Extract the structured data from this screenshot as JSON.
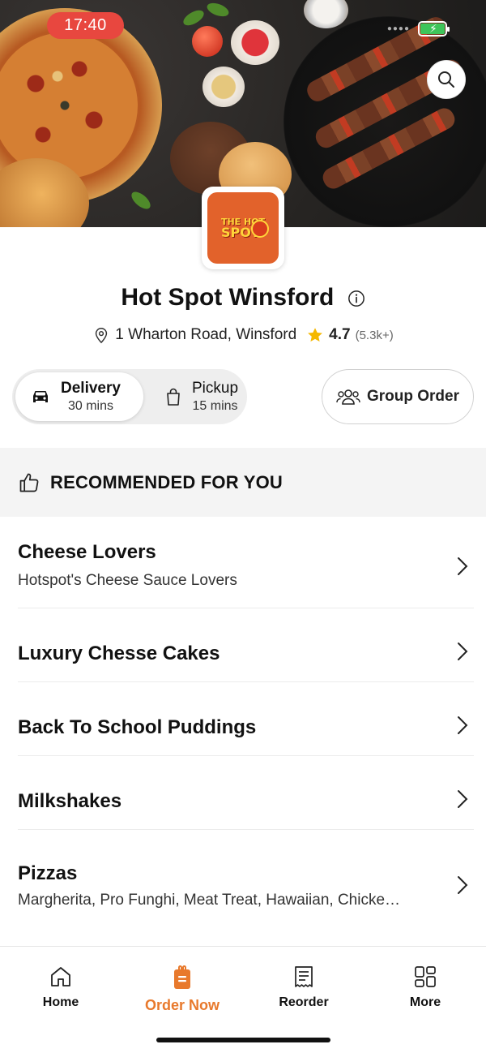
{
  "status_bar": {
    "time": "17:40"
  },
  "store": {
    "name": "Hot Spot Winsford",
    "logo_text_line1": "THE HOT",
    "logo_text_line2": "SPOT",
    "address": "1 Wharton Road, Winsford",
    "rating": "4.7",
    "reviews": "(5.3k+)"
  },
  "order_mode": {
    "delivery": {
      "label": "Delivery",
      "time": "30 mins"
    },
    "pickup": {
      "label": "Pickup",
      "time": "15 mins"
    },
    "selected": "delivery"
  },
  "group_order": {
    "label": "Group Order"
  },
  "section": {
    "title": "RECOMMENDED FOR YOU"
  },
  "menu": [
    {
      "title": "Cheese Lovers",
      "subtitle": "Hotspot's Cheese Sauce Lovers"
    },
    {
      "title": "Luxury Chesse Cakes",
      "subtitle": ""
    },
    {
      "title": "Back To School Puddings",
      "subtitle": ""
    },
    {
      "title": "Milkshakes",
      "subtitle": ""
    },
    {
      "title": "Pizzas",
      "subtitle": "Margherita, Pro Funghi, Meat Treat, Hawaiian, Chicke…"
    }
  ],
  "tabs": [
    {
      "label": "Home",
      "icon": "home-icon"
    },
    {
      "label": "Order Now",
      "icon": "order-bag-icon"
    },
    {
      "label": "Reorder",
      "icon": "receipt-icon"
    },
    {
      "label": "More",
      "icon": "grid-icon"
    }
  ],
  "colors": {
    "accent": "#e8792c",
    "time_pill": "#e8473f",
    "star": "#f5b800",
    "battery": "#3ec55a"
  }
}
